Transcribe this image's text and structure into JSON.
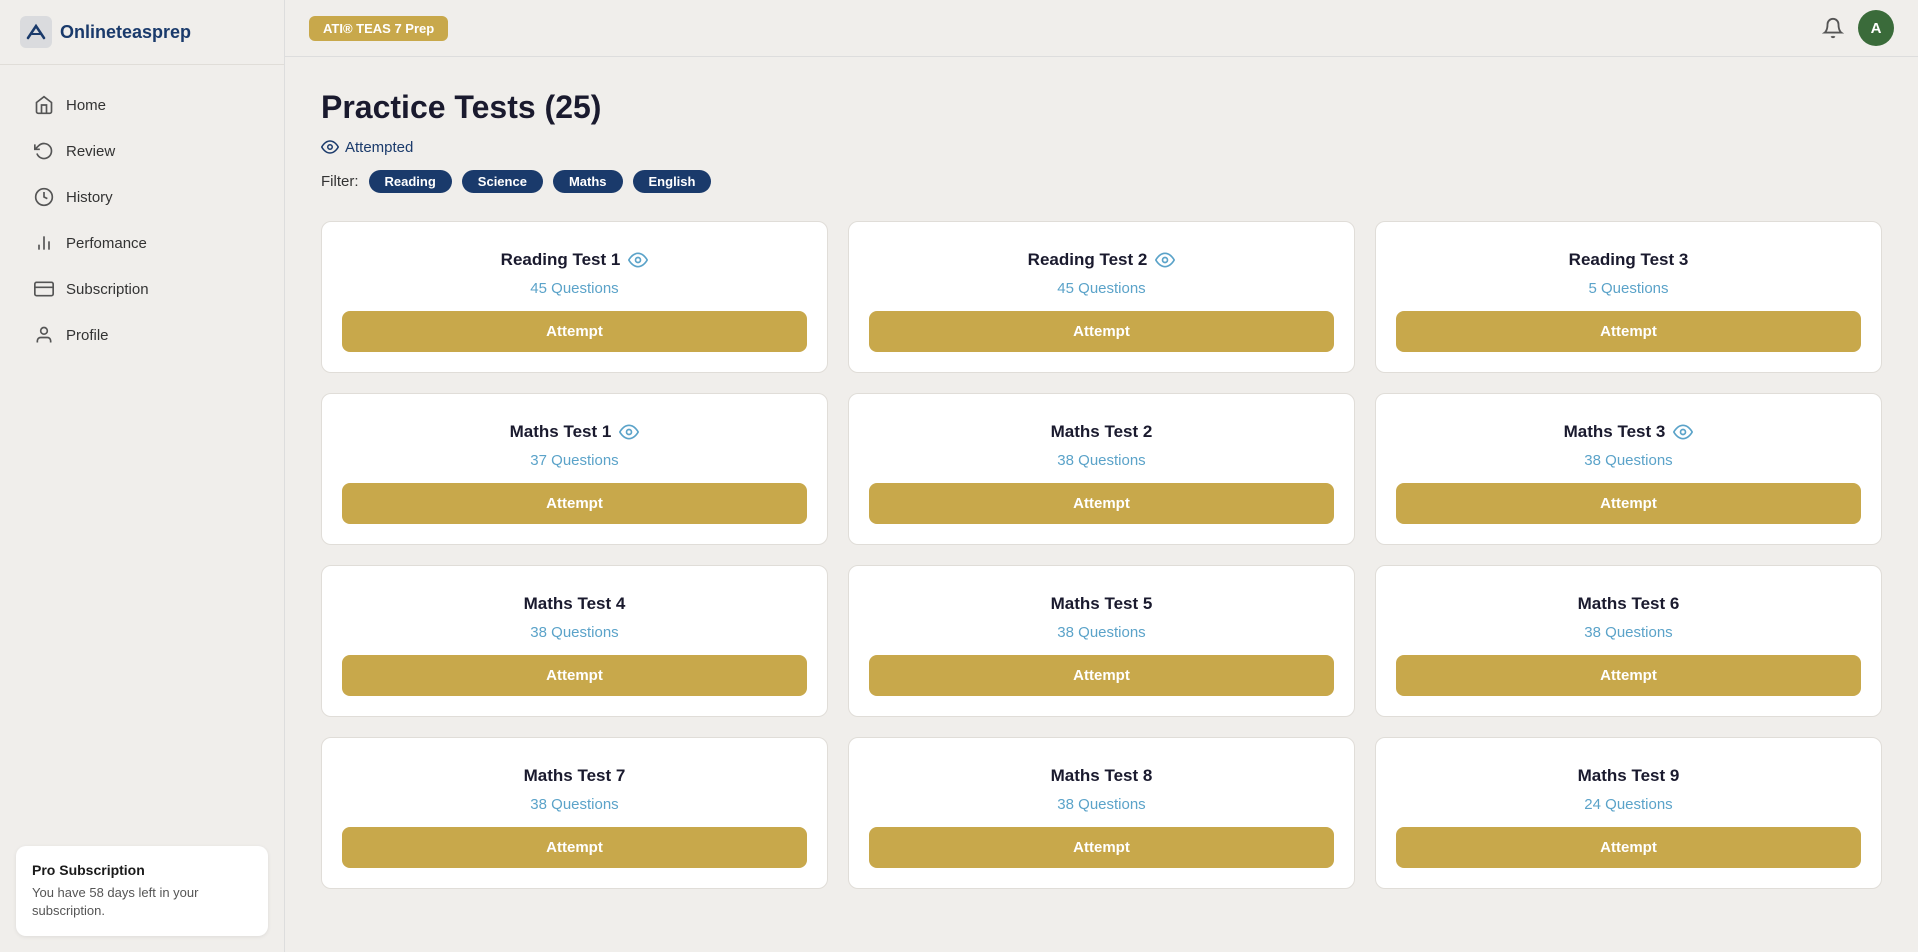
{
  "logo": {
    "text": "Onlineteasprep"
  },
  "topbar": {
    "badge": "ATI® TEAS 7 Prep",
    "avatar_letter": "A"
  },
  "sidebar": {
    "nav_items": [
      {
        "id": "home",
        "label": "Home",
        "icon": "home"
      },
      {
        "id": "review",
        "label": "Review",
        "icon": "refresh"
      },
      {
        "id": "history",
        "label": "History",
        "icon": "history"
      },
      {
        "id": "performance",
        "label": "Perfomance",
        "icon": "chart"
      },
      {
        "id": "subscription",
        "label": "Subscription",
        "icon": "card"
      },
      {
        "id": "profile",
        "label": "Profile",
        "icon": "user"
      }
    ]
  },
  "subscription_box": {
    "title": "Pro Subscription",
    "description": "You have 58 days left in your subscription."
  },
  "page": {
    "title": "Practice Tests (25)",
    "attempted_label": "Attempted",
    "filter_label": "Filter:",
    "filters": [
      "Reading",
      "Science",
      "Maths",
      "English"
    ]
  },
  "cards": [
    {
      "title": "Reading Test 1",
      "questions": "45 Questions",
      "has_eye": true,
      "button": "Attempt"
    },
    {
      "title": "Reading Test 2",
      "questions": "45 Questions",
      "has_eye": true,
      "button": "Attempt"
    },
    {
      "title": "Reading Test 3",
      "questions": "5 Questions",
      "has_eye": false,
      "button": "Attempt"
    },
    {
      "title": "Maths Test 1",
      "questions": "37 Questions",
      "has_eye": true,
      "button": "Attempt"
    },
    {
      "title": "Maths Test 2",
      "questions": "38 Questions",
      "has_eye": false,
      "button": "Attempt"
    },
    {
      "title": "Maths Test 3",
      "questions": "38 Questions",
      "has_eye": true,
      "button": "Attempt"
    },
    {
      "title": "Maths Test 4",
      "questions": "38 Questions",
      "has_eye": false,
      "button": "Attempt"
    },
    {
      "title": "Maths Test 5",
      "questions": "38 Questions",
      "has_eye": false,
      "button": "Attempt"
    },
    {
      "title": "Maths Test 6",
      "questions": "38 Questions",
      "has_eye": false,
      "button": "Attempt"
    },
    {
      "title": "Maths Test 7",
      "questions": "38 Questions",
      "has_eye": false,
      "button": "Attempt"
    },
    {
      "title": "Maths Test 8",
      "questions": "38 Questions",
      "has_eye": false,
      "button": "Attempt"
    },
    {
      "title": "Maths Test 9",
      "questions": "24 Questions",
      "has_eye": false,
      "button": "Attempt"
    }
  ]
}
